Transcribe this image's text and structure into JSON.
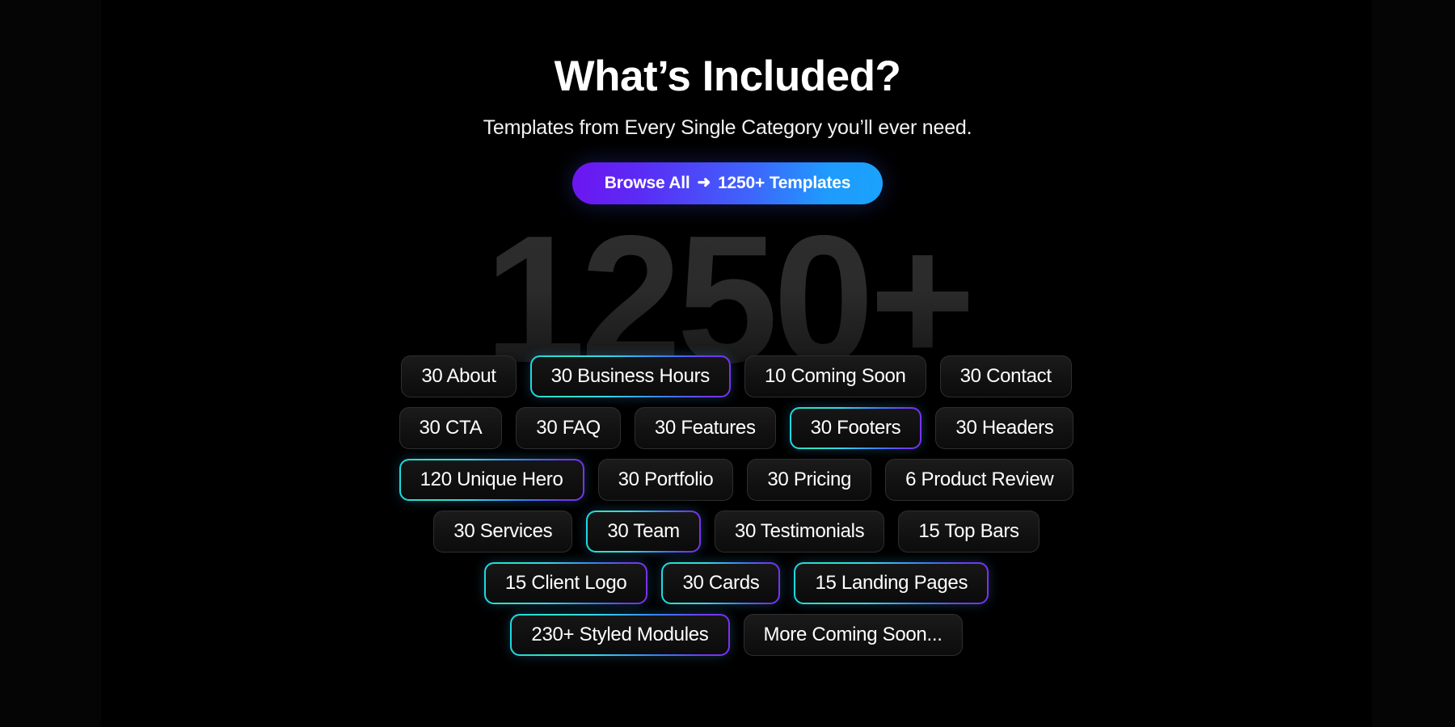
{
  "header": {
    "title": "What’s Included?",
    "subtitle": "Templates from Every Single Category you’ll ever need.",
    "cta": {
      "label_before": "Browse All",
      "arrow": "➜",
      "label_after": "1250+ Templates"
    }
  },
  "watermark": {
    "text": "1250+"
  },
  "colors": {
    "background": "#000000",
    "tag_background": "#121212",
    "tag_border": "#2e2e2e",
    "text": "#ffffff",
    "watermark": "#2a2a2a",
    "accent_cyan": "#1fd8e0",
    "accent_green": "#2ee6c4",
    "accent_blue": "#3b7df5",
    "accent_purple": "#7b31f0",
    "cta_gradient_start": "#6d15f0",
    "cta_gradient_end": "#1aa3fd"
  },
  "tag_rows": [
    {
      "tags": [
        {
          "label": "30 About",
          "highlight": false
        },
        {
          "label": "30 Business Hours",
          "highlight": true
        },
        {
          "label": "10 Coming Soon",
          "highlight": false
        },
        {
          "label": "30 Contact",
          "highlight": false
        }
      ]
    },
    {
      "tags": [
        {
          "label": "30 CTA",
          "highlight": false
        },
        {
          "label": "30 FAQ",
          "highlight": false
        },
        {
          "label": "30 Features",
          "highlight": false
        },
        {
          "label": "30 Footers",
          "highlight": true
        },
        {
          "label": "30 Headers",
          "highlight": false
        }
      ]
    },
    {
      "tags": [
        {
          "label": "120 Unique Hero",
          "highlight": true
        },
        {
          "label": "30 Portfolio",
          "highlight": false
        },
        {
          "label": "30 Pricing",
          "highlight": false
        },
        {
          "label": "6 Product Review",
          "highlight": false
        }
      ]
    },
    {
      "tags": [
        {
          "label": "30 Services",
          "highlight": false
        },
        {
          "label": "30 Team",
          "highlight": true
        },
        {
          "label": "30 Testimonials",
          "highlight": false
        },
        {
          "label": "15 Top Bars",
          "highlight": false
        }
      ]
    },
    {
      "tags": [
        {
          "label": "15 Client Logo",
          "highlight": true
        },
        {
          "label": "30 Cards",
          "highlight": true
        },
        {
          "label": "15 Landing Pages",
          "highlight": true
        }
      ]
    },
    {
      "tags": [
        {
          "label": "230+ Styled Modules",
          "highlight": true
        },
        {
          "label": "More Coming Soon...",
          "highlight": false
        }
      ]
    }
  ]
}
